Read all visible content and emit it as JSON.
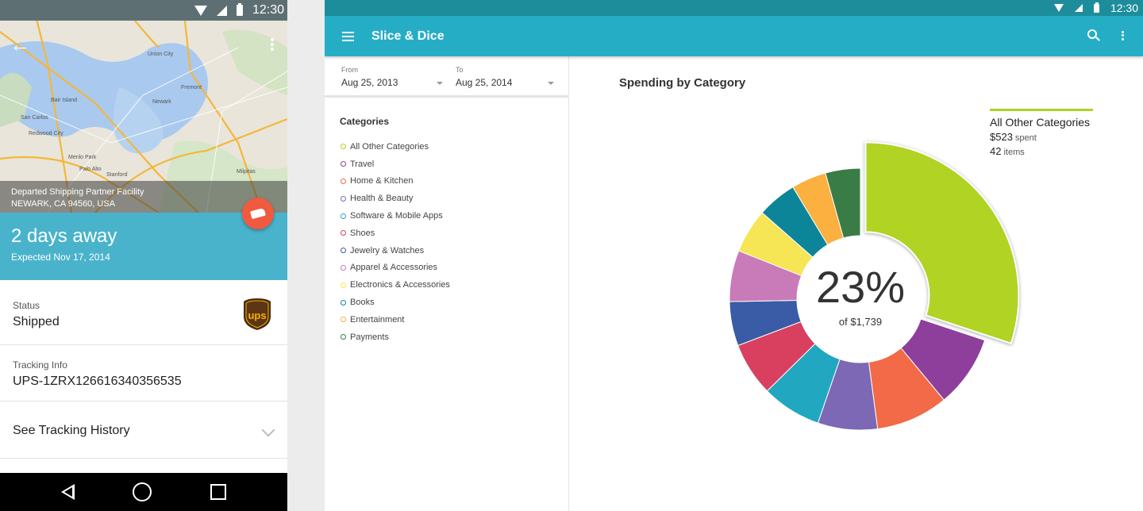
{
  "phone": {
    "status_time": "12:30",
    "map_caption_line1": "Departed Shipping Partner Facility",
    "map_caption_line2": "NEWARK, CA 94560, USA",
    "eta_title": "2 days away",
    "eta_sub": "Expected Nov 17, 2014",
    "status_label": "Status",
    "status_value": "Shipped",
    "tracking_label": "Tracking Info",
    "tracking_value": "UPS-1ZRX126616340356535",
    "history_label": "See Tracking History",
    "colors": {
      "band": "#4ab3cc",
      "fab": "#f05a3f"
    },
    "map_labels": [
      "Union City",
      "Fremont",
      "Newark",
      "San Carlos",
      "Redwood City",
      "Menlo Park",
      "Palo Alto",
      "Milpitas",
      "Stanford",
      "Bair Island"
    ]
  },
  "tablet": {
    "status_time": "12:30",
    "app_title": "Slice & Dice",
    "from_label": "From",
    "from_value": "Aug 25, 2013",
    "to_label": "To",
    "to_value": "Aug 25, 2014",
    "categories_heading": "Categories",
    "chart_title": "Spending by Category",
    "colors": {
      "toolbar": "#26adc6",
      "statusbar": "#1d8d9c"
    },
    "legend": {
      "name": "All Other Categories",
      "amount": "$523",
      "amount_suffix": "spent",
      "items": "42",
      "items_suffix": "items"
    },
    "center_percent": "23%",
    "center_sub": "of $1,739"
  },
  "chart_data": {
    "type": "pie",
    "title": "Spending by Category",
    "total": 1739,
    "highlighted": "All Other Categories",
    "categories": [
      {
        "name": "All Other Categories",
        "value": 523,
        "color": "#b0d324"
      },
      {
        "name": "Travel",
        "value": 155,
        "color": "#8e3f9c"
      },
      {
        "name": "Home & Kitchen",
        "value": 155,
        "color": "#f26a47"
      },
      {
        "name": "Health & Beauty",
        "value": 128,
        "color": "#7c68b5"
      },
      {
        "name": "Software & Mobile Apps",
        "value": 128,
        "color": "#21a7bf"
      },
      {
        "name": "Shoes",
        "value": 115,
        "color": "#d9405f"
      },
      {
        "name": "Jewelry & Watches",
        "value": 95,
        "color": "#3a5ba6"
      },
      {
        "name": "Apparel & Accessories",
        "value": 110,
        "color": "#c97ab8"
      },
      {
        "name": "Electronics & Accessories",
        "value": 95,
        "color": "#f6e554"
      },
      {
        "name": "Books",
        "value": 85,
        "color": "#0d8599"
      },
      {
        "name": "Entertainment",
        "value": 75,
        "color": "#fbb03f"
      },
      {
        "name": "Payments",
        "value": 75,
        "color": "#3a7c45"
      }
    ]
  }
}
